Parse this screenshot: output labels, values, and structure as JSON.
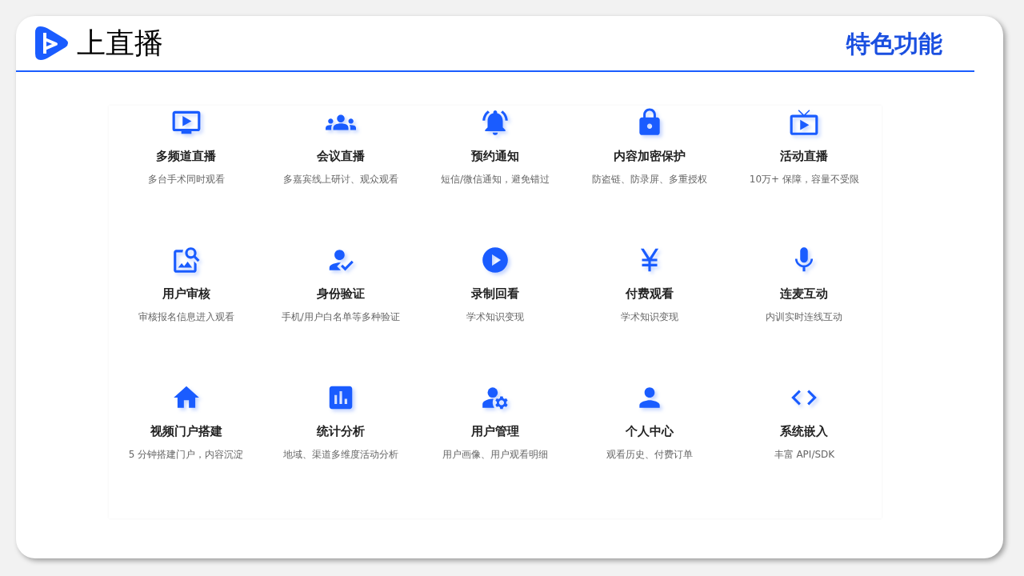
{
  "header": {
    "brand": "上直播",
    "title": "特色功能"
  },
  "features": [
    {
      "title": "多频道直播",
      "subtitle": "多台手术同时观看"
    },
    {
      "title": "会议直播",
      "subtitle": "多嘉宾线上研讨、观众观看"
    },
    {
      "title": "预约通知",
      "subtitle": "短信/微信通知，避免错过"
    },
    {
      "title": "内容加密保护",
      "subtitle": "防盗链、防录屏、多重授权"
    },
    {
      "title": "活动直播",
      "subtitle": "10万+ 保障，容量不受限"
    },
    {
      "title": "用户审核",
      "subtitle": "审核报名信息进入观看"
    },
    {
      "title": "身份验证",
      "subtitle": "手机/用户白名单等多种验证"
    },
    {
      "title": "录制回看",
      "subtitle": "学术知识变现"
    },
    {
      "title": "付费观看",
      "subtitle": "学术知识变现"
    },
    {
      "title": "连麦互动",
      "subtitle": "内训实时连线互动"
    },
    {
      "title": "视频门户搭建",
      "subtitle": "5 分钟搭建门户，内容沉淀"
    },
    {
      "title": "统计分析",
      "subtitle": "地域、渠道多维度活动分析"
    },
    {
      "title": "用户管理",
      "subtitle": "用户画像、用户观看明细"
    },
    {
      "title": "个人中心",
      "subtitle": "观看历史、付费订单"
    },
    {
      "title": "系统嵌入",
      "subtitle": "丰富 API/SDK"
    }
  ]
}
